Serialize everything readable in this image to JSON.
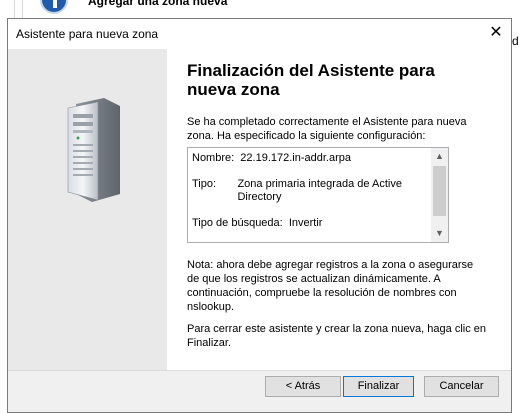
{
  "background": {
    "window_title": "Agregar una zona nueva",
    "right_edge_char": "d"
  },
  "dialog": {
    "title": "Asistente para nueva zona",
    "close_symbol": "✕",
    "heading": "Finalización del Asistente para nueva zona",
    "intro": "Se ha completado correctamente el Asistente para nueva zona. Ha especificado la siguiente configuración:",
    "summary": {
      "name_label": "Nombre:  ",
      "name_value": "22.19.172.in-addr.arpa",
      "type_label": "Tipo:       ",
      "type_value": "Zona primaria integrada de Active Directory",
      "lookup_label": "Tipo de búsqueda:  ",
      "lookup_value": "Invertir"
    },
    "note": "Nota: ahora debe agregar registros a la zona o asegurarse de que los registros se actualizan dinámicamente. A continuación, compruebe la resolución de nombres con nslookup.",
    "finish_text": "Para cerrar este asistente y crear la zona nueva, haga clic en Finalizar.",
    "buttons": {
      "back": "< Atrás",
      "finish": "Finalizar",
      "cancel": "Cancelar"
    }
  },
  "icons": {
    "app_icon": "info-circle-icon",
    "illustration": "server-tower-icon",
    "scroll_up": "chevron-up-icon",
    "scroll_down": "chevron-down-icon"
  },
  "colors": {
    "accent": "#0078d7",
    "dialog_bg": "#f0f0f0",
    "left_panel_bg": "#e9e9e9"
  }
}
